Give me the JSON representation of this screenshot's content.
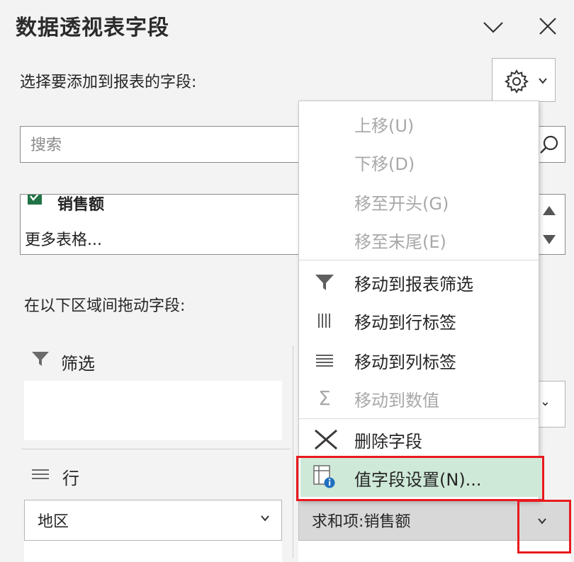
{
  "header": {
    "title": "数据透视表字段"
  },
  "fields": {
    "prompt": "选择要添加到报表的字段:",
    "search_placeholder": "搜索",
    "items": [
      {
        "label": "销售额",
        "checked": true
      },
      {
        "label": "更多表格..."
      }
    ]
  },
  "areas": {
    "prompt": "在以下区域间拖动字段:",
    "filter_label": "筛选",
    "rows_label": "行",
    "row_field": "地区",
    "value_field": "求和项:销售额"
  },
  "context_menu": {
    "items": [
      {
        "label": "上移(U)",
        "mnemonic": "U",
        "enabled": false,
        "icon": "none"
      },
      {
        "label": "下移(D)",
        "mnemonic": "D",
        "enabled": false,
        "icon": "none"
      },
      {
        "label": "移至开头(G)",
        "mnemonic": "G",
        "enabled": false,
        "icon": "none"
      },
      {
        "label": "移至末尾(E)",
        "mnemonic": "E",
        "enabled": false,
        "icon": "none"
      },
      {
        "label": "移动到报表筛选",
        "enabled": true,
        "icon": "filter-icon"
      },
      {
        "label": "移动到行标签",
        "enabled": true,
        "icon": "row-labels-icon"
      },
      {
        "label": "移动到列标签",
        "enabled": true,
        "icon": "column-labels-icon"
      },
      {
        "label": "移动到数值",
        "enabled": false,
        "icon": "sigma-icon"
      },
      {
        "label": "删除字段",
        "enabled": true,
        "icon": "delete-x-icon"
      },
      {
        "label": "值字段设置(N)...",
        "mnemonic": "N",
        "enabled": true,
        "icon": "field-settings-icon",
        "highlighted": true
      }
    ]
  },
  "colors": {
    "accent_green": "#217346",
    "highlight": "#cfe9d8",
    "annotation_red": "#e8191e"
  }
}
